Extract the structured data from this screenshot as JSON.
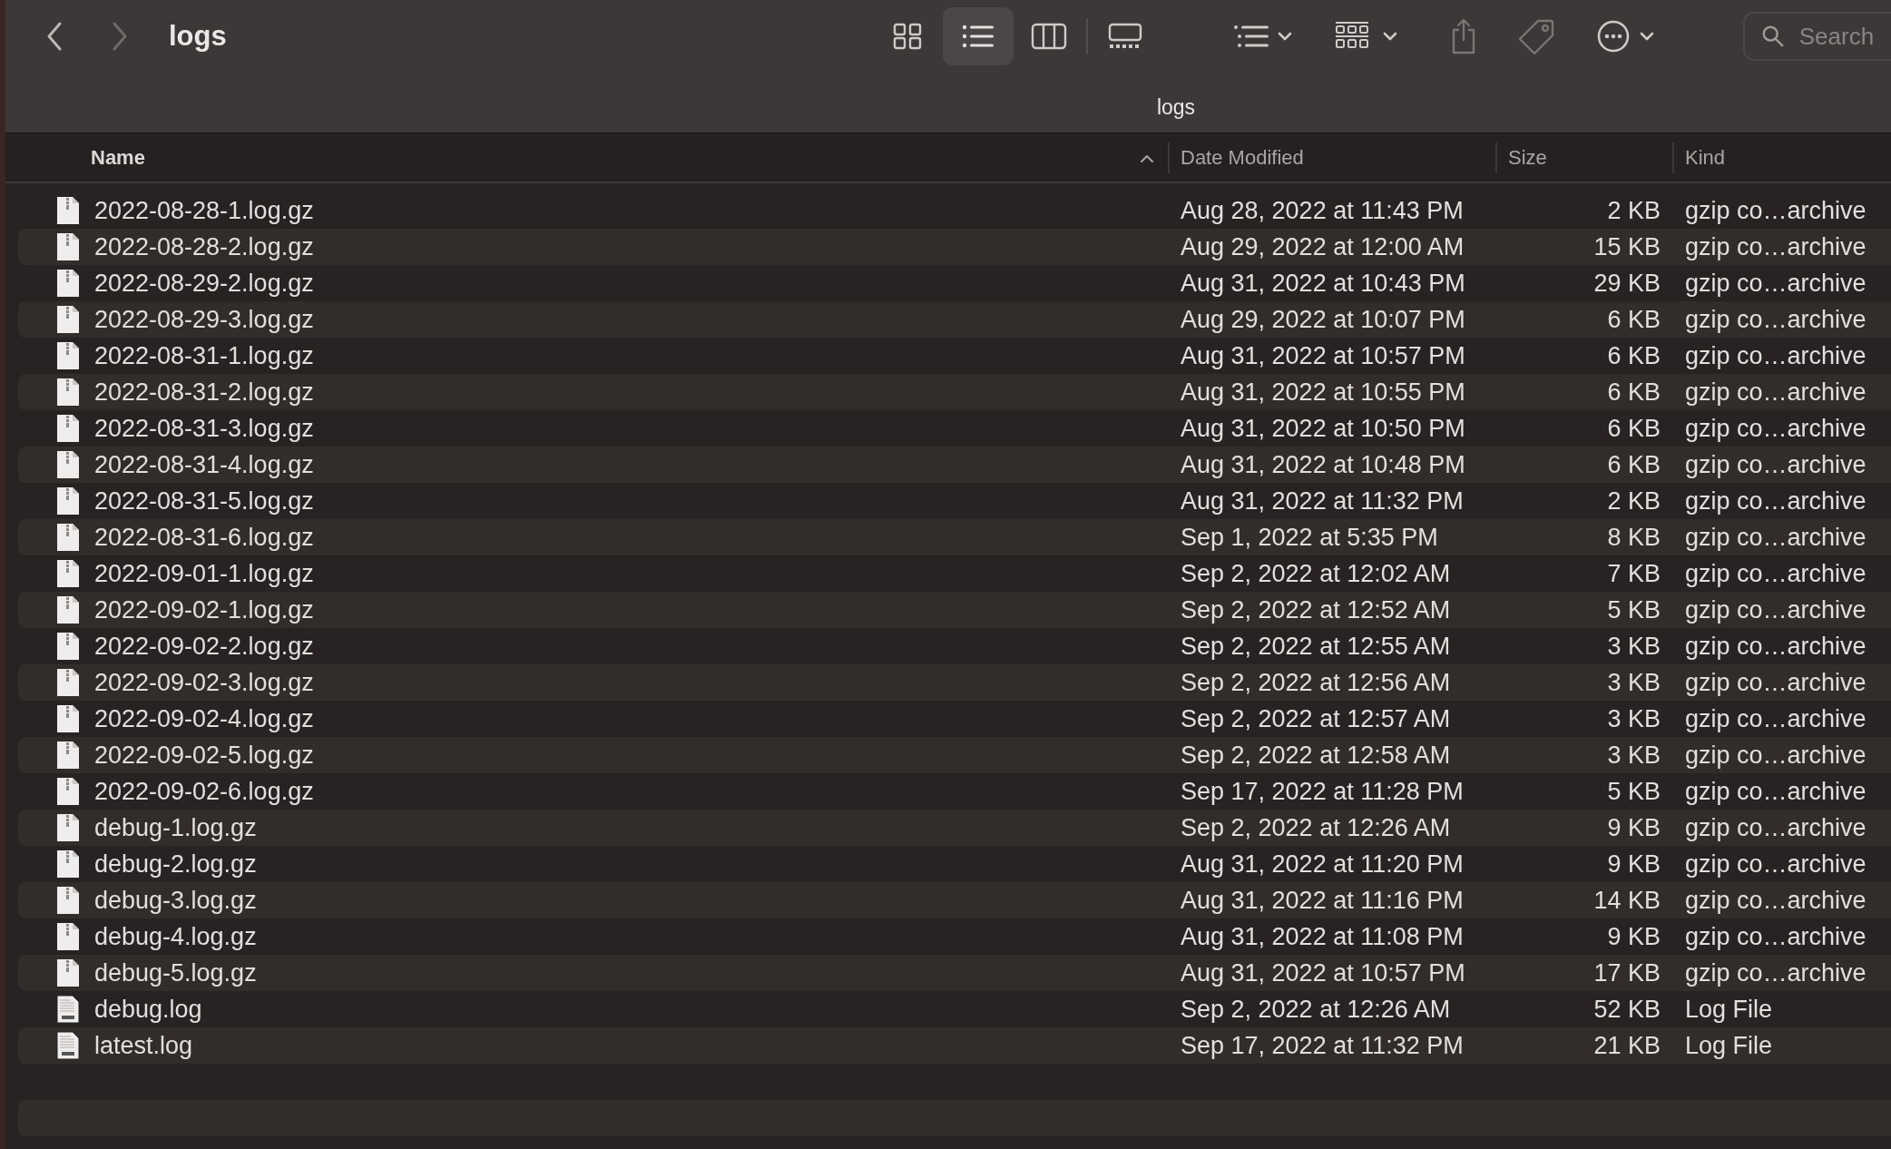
{
  "toolbar": {
    "title": "logs",
    "view_buttons": [
      {
        "kind": "icons",
        "selected": false
      },
      {
        "kind": "list",
        "selected": true
      },
      {
        "kind": "columns",
        "selected": false
      },
      {
        "kind": "gallery",
        "selected": false
      }
    ],
    "search": {
      "placeholder": "Search"
    }
  },
  "path_title": "logs",
  "columns": [
    {
      "label": "Name",
      "sorted": true
    },
    {
      "label": "Date Modified",
      "sorted": false
    },
    {
      "label": "Size",
      "sorted": false
    },
    {
      "label": "Kind",
      "sorted": false
    }
  ],
  "rows": [
    {
      "name": "2022-08-28-1.log.gz",
      "date": "Aug 28, 2022 at 11:43 PM",
      "size": "2 KB",
      "kind_label": "gzip co…archive",
      "kind": "archive"
    },
    {
      "name": "2022-08-28-2.log.gz",
      "date": "Aug 29, 2022 at 12:00 AM",
      "size": "15 KB",
      "kind_label": "gzip co…archive",
      "kind": "archive"
    },
    {
      "name": "2022-08-29-2.log.gz",
      "date": "Aug 31, 2022 at 10:43 PM",
      "size": "29 KB",
      "kind_label": "gzip co…archive",
      "kind": "archive"
    },
    {
      "name": "2022-08-29-3.log.gz",
      "date": "Aug 29, 2022 at 10:07 PM",
      "size": "6 KB",
      "kind_label": "gzip co…archive",
      "kind": "archive"
    },
    {
      "name": "2022-08-31-1.log.gz",
      "date": "Aug 31, 2022 at 10:57 PM",
      "size": "6 KB",
      "kind_label": "gzip co…archive",
      "kind": "archive"
    },
    {
      "name": "2022-08-31-2.log.gz",
      "date": "Aug 31, 2022 at 10:55 PM",
      "size": "6 KB",
      "kind_label": "gzip co…archive",
      "kind": "archive"
    },
    {
      "name": "2022-08-31-3.log.gz",
      "date": "Aug 31, 2022 at 10:50 PM",
      "size": "6 KB",
      "kind_label": "gzip co…archive",
      "kind": "archive"
    },
    {
      "name": "2022-08-31-4.log.gz",
      "date": "Aug 31, 2022 at 10:48 PM",
      "size": "6 KB",
      "kind_label": "gzip co…archive",
      "kind": "archive"
    },
    {
      "name": "2022-08-31-5.log.gz",
      "date": "Aug 31, 2022 at 11:32 PM",
      "size": "2 KB",
      "kind_label": "gzip co…archive",
      "kind": "archive"
    },
    {
      "name": "2022-08-31-6.log.gz",
      "date": "Sep 1, 2022 at 5:35 PM",
      "size": "8 KB",
      "kind_label": "gzip co…archive",
      "kind": "archive"
    },
    {
      "name": "2022-09-01-1.log.gz",
      "date": "Sep 2, 2022 at 12:02 AM",
      "size": "7 KB",
      "kind_label": "gzip co…archive",
      "kind": "archive"
    },
    {
      "name": "2022-09-02-1.log.gz",
      "date": "Sep 2, 2022 at 12:52 AM",
      "size": "5 KB",
      "kind_label": "gzip co…archive",
      "kind": "archive"
    },
    {
      "name": "2022-09-02-2.log.gz",
      "date": "Sep 2, 2022 at 12:55 AM",
      "size": "3 KB",
      "kind_label": "gzip co…archive",
      "kind": "archive"
    },
    {
      "name": "2022-09-02-3.log.gz",
      "date": "Sep 2, 2022 at 12:56 AM",
      "size": "3 KB",
      "kind_label": "gzip co…archive",
      "kind": "archive"
    },
    {
      "name": "2022-09-02-4.log.gz",
      "date": "Sep 2, 2022 at 12:57 AM",
      "size": "3 KB",
      "kind_label": "gzip co…archive",
      "kind": "archive"
    },
    {
      "name": "2022-09-02-5.log.gz",
      "date": "Sep 2, 2022 at 12:58 AM",
      "size": "3 KB",
      "kind_label": "gzip co…archive",
      "kind": "archive"
    },
    {
      "name": "2022-09-02-6.log.gz",
      "date": "Sep 17, 2022 at 11:28 PM",
      "size": "5 KB",
      "kind_label": "gzip co…archive",
      "kind": "archive"
    },
    {
      "name": "debug-1.log.gz",
      "date": "Sep 2, 2022 at 12:26 AM",
      "size": "9 KB",
      "kind_label": "gzip co…archive",
      "kind": "archive"
    },
    {
      "name": "debug-2.log.gz",
      "date": "Aug 31, 2022 at 11:20 PM",
      "size": "9 KB",
      "kind_label": "gzip co…archive",
      "kind": "archive"
    },
    {
      "name": "debug-3.log.gz",
      "date": "Aug 31, 2022 at 11:16 PM",
      "size": "14 KB",
      "kind_label": "gzip co…archive",
      "kind": "archive"
    },
    {
      "name": "debug-4.log.gz",
      "date": "Aug 31, 2022 at 11:08 PM",
      "size": "9 KB",
      "kind_label": "gzip co…archive",
      "kind": "archive"
    },
    {
      "name": "debug-5.log.gz",
      "date": "Aug 31, 2022 at 10:57 PM",
      "size": "17 KB",
      "kind_label": "gzip co…archive",
      "kind": "archive"
    },
    {
      "name": "debug.log",
      "date": "Sep 2, 2022 at 12:26 AM",
      "size": "52 KB",
      "kind_label": "Log File",
      "kind": "log"
    },
    {
      "name": "latest.log",
      "date": "Sep 17, 2022 at 11:32 PM",
      "size": "21 KB",
      "kind_label": "Log File",
      "kind": "log"
    }
  ]
}
